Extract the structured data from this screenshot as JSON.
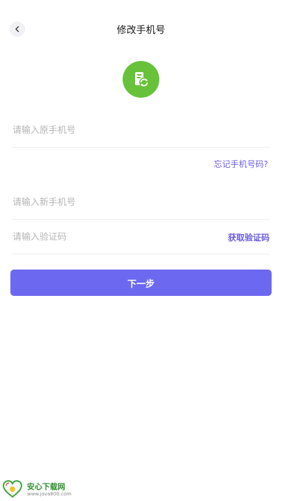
{
  "header": {
    "title": "修改手机号"
  },
  "form": {
    "old_phone_placeholder": "请输入原手机号",
    "forgot_link": "忘记手机号码?",
    "new_phone_placeholder": "请输入新手机号",
    "code_placeholder": "请输入验证码",
    "get_code_label": "获取验证码",
    "next_button": "下一步"
  },
  "watermark": {
    "title": "安心下载网",
    "url": "www.java800.com"
  },
  "colors": {
    "accent": "#6b5ce7",
    "button": "#6d68f0",
    "logo_bg": "#67c23a"
  },
  "icons": {
    "back": "chevron-left-icon",
    "logo": "phone-swap-icon"
  }
}
